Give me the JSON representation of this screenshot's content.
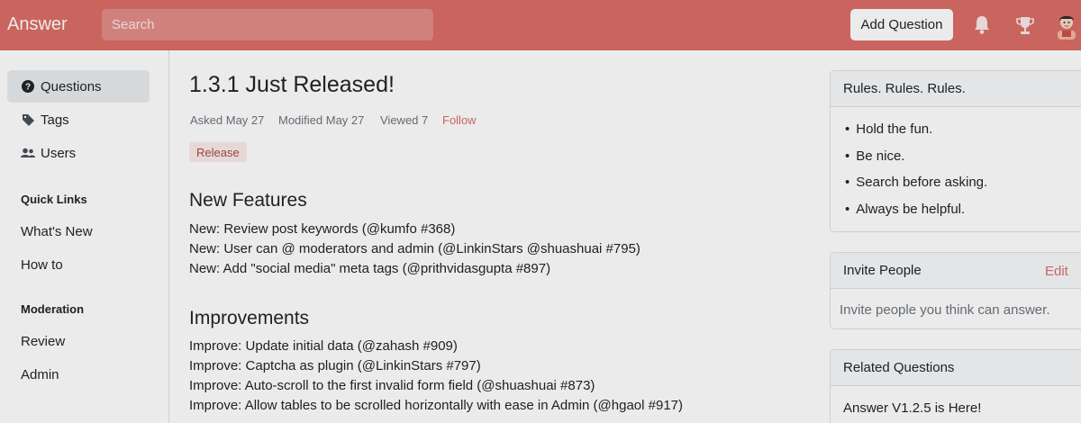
{
  "header": {
    "brand": "Answer",
    "search_placeholder": "Search",
    "add_question_label": "Add Question",
    "bg_color": "#db6e67"
  },
  "sidebar": {
    "items": [
      {
        "label": "Questions",
        "icon": "question-circle-icon",
        "active": true
      },
      {
        "label": "Tags",
        "icon": "tag-icon",
        "active": false
      },
      {
        "label": "Users",
        "icon": "users-icon",
        "active": false
      }
    ],
    "quick_links": {
      "heading": "Quick Links",
      "links": [
        "What's New",
        "How to"
      ]
    },
    "moderation": {
      "heading": "Moderation",
      "links": [
        "Review",
        "Admin"
      ]
    }
  },
  "question": {
    "title": "1.3.1 Just Released!",
    "asked": "Asked May 27",
    "modified": "Modified May 27",
    "viewed": "Viewed 7",
    "follow": "Follow",
    "tag": "Release"
  },
  "body": {
    "new_features_heading": "New Features",
    "new_features": [
      "New: Review post keywords (@kumfo #368)",
      "New: User can @ moderators and admin (@LinkinStars @shuashuai #795)",
      "New: Add \"social media\" meta tags (@prithvidasgupta #897)"
    ],
    "improvements_heading": "Improvements",
    "improvements": [
      "Improve: Update initial data (@zahash #909)",
      "Improve: Captcha as plugin (@LinkinStars #797)",
      "Improve: Auto-scroll to the first invalid form field (@shuashuai #873)",
      "Improve: Allow tables to be scrolled horizontally with ease in Admin (@hgaol #917)"
    ]
  },
  "right": {
    "rules": {
      "heading": "Rules. Rules. Rules.",
      "items": [
        "Hold the fun.",
        "Be nice.",
        "Search before asking.",
        "Always be helpful."
      ]
    },
    "invite": {
      "heading": "Invite People",
      "edit": "Edit",
      "text": "Invite people you think can answer."
    },
    "related": {
      "heading": "Related Questions",
      "items": [
        "Answer V1.2.5 is Here!"
      ]
    }
  },
  "colors": {
    "accent": "#db6e67",
    "tag_text": "#a94b45",
    "muted": "#6c757d"
  }
}
